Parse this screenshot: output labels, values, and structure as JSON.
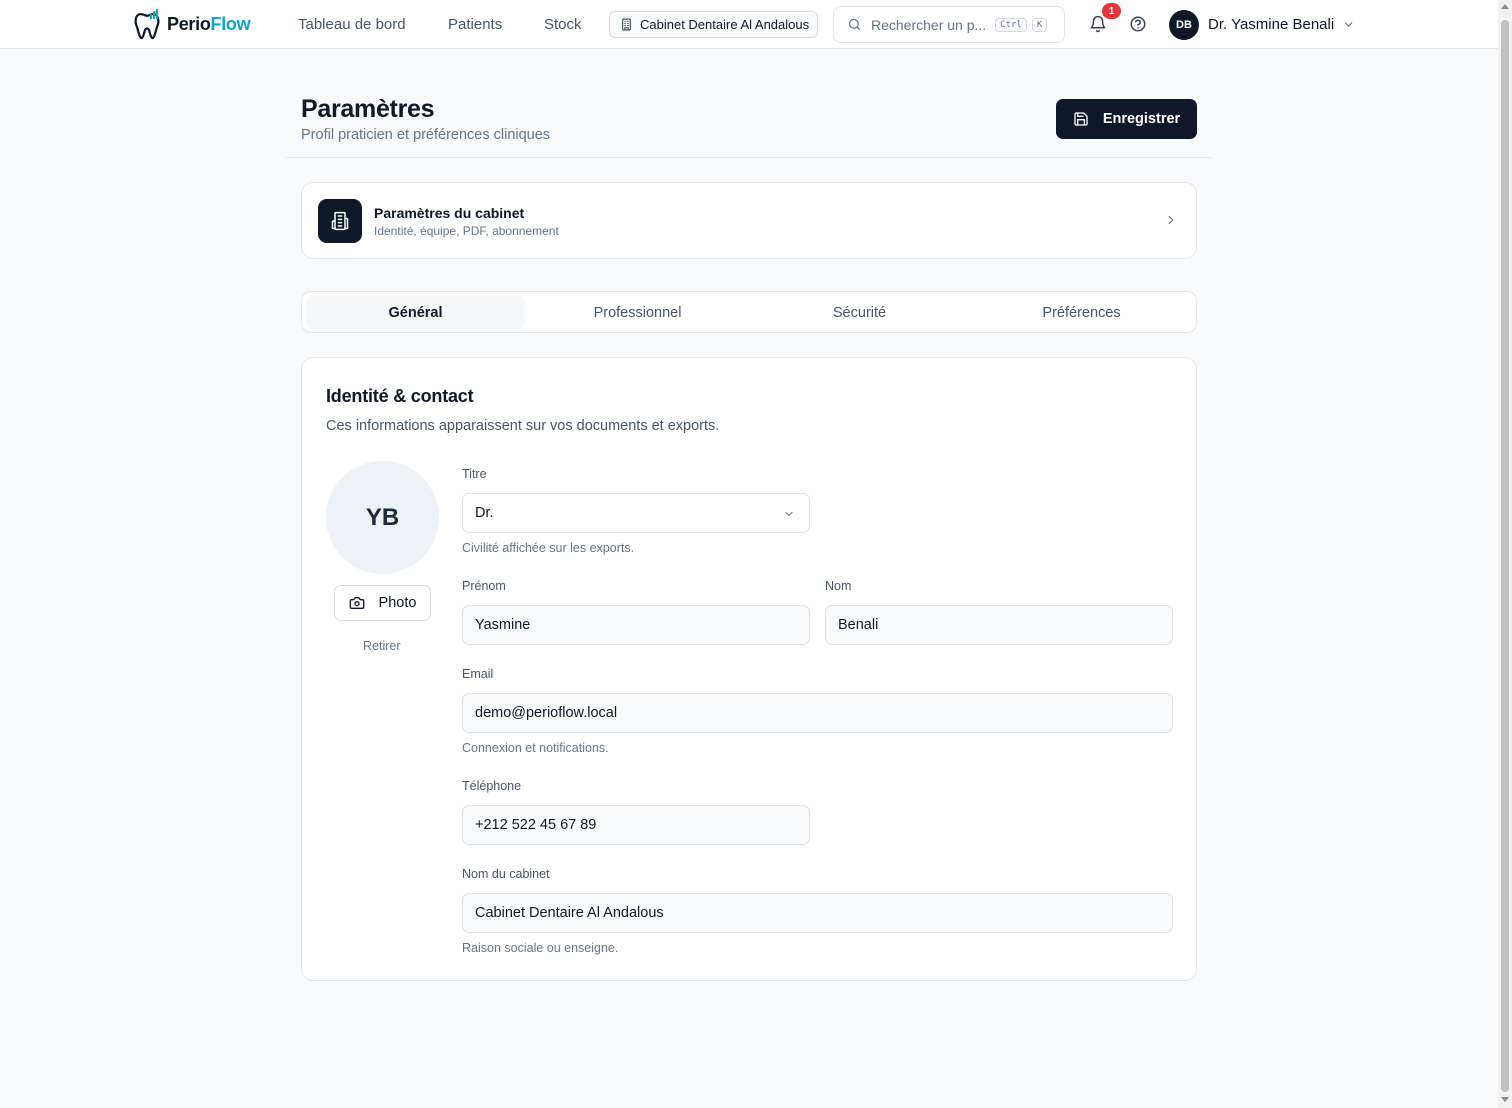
{
  "brand": {
    "part1": "Perio",
    "part2": "Flow",
    "accent": "#0ea5c6"
  },
  "nav": {
    "items": [
      "Tableau de bord",
      "Patients",
      "Stock"
    ],
    "cabinet_chip": "Cabinet Dentaire Al Andalous",
    "search_placeholder": "Rechercher un p...",
    "search_kbd_1": "Ctrl",
    "search_kbd_2": "K",
    "notification_count": "1",
    "user_initials": "DB",
    "user_name": "Dr. Yasmine Benali"
  },
  "header": {
    "title": "Paramètres",
    "subtitle": "Profil praticien et préférences cliniques",
    "save_label": "Enregistrer"
  },
  "cabinet_card": {
    "title": "Paramètres du cabinet",
    "subtitle": "Identité, équipe, PDF, abonnement"
  },
  "tabs": [
    "Général",
    "Professionnel",
    "Sécurité",
    "Préférences"
  ],
  "active_tab": "Général",
  "form": {
    "section_title": "Identité & contact",
    "section_subtitle": "Ces informations apparaissent sur vos documents et exports.",
    "avatar_initials": "YB",
    "photo_label": "Photo",
    "remove_label": "Retirer",
    "titre": {
      "label": "Titre",
      "value": "Dr.",
      "hint": "Civilité affichée sur les exports."
    },
    "prenom": {
      "label": "Prénom",
      "value": "Yasmine"
    },
    "nom": {
      "label": "Nom",
      "value": "Benali"
    },
    "email": {
      "label": "Email",
      "value": "demo@perioflow.local",
      "hint": "Connexion et notifications."
    },
    "telephone": {
      "label": "Téléphone",
      "value": "+212 522 45 67 89"
    },
    "cabinet": {
      "label": "Nom du cabinet",
      "value": "Cabinet Dentaire Al Andalous",
      "hint": "Raison sociale ou enseigne."
    }
  },
  "colors": {
    "primary_dark": "#0f172a",
    "badge_red": "#e5363d",
    "page_bg": "#f8f9fb"
  }
}
